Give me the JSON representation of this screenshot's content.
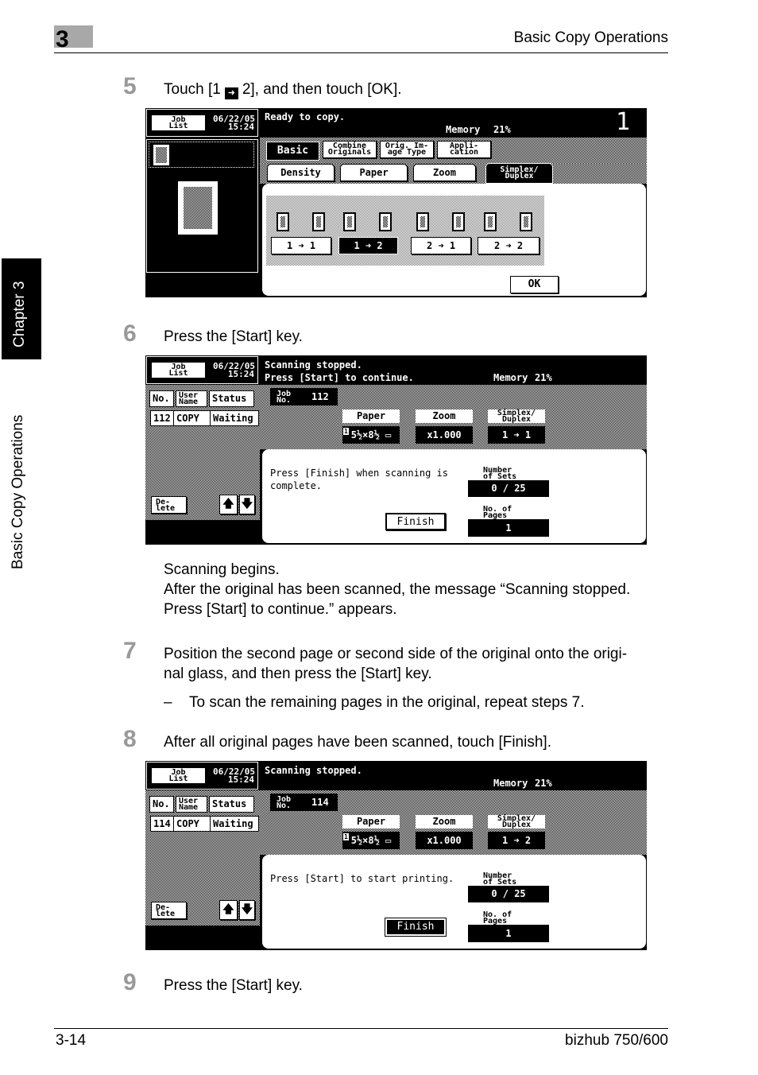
{
  "header": {
    "chapter_number": "3",
    "title": "Basic Copy Operations"
  },
  "side": {
    "chapter": "Chapter 3",
    "section": "Basic Copy Operations"
  },
  "steps": [
    {
      "num": "5",
      "text_before": "Touch [1",
      "text_after": "2], and then touch [OK].",
      "icon": "duplex-arrow-icon"
    },
    {
      "num": "6",
      "text": "Press the [Start] key.",
      "after": [
        "Scanning begins.",
        "After the original has been scanned, the message “Scanning stopped.",
        "Press [Start] to continue.” appears."
      ]
    },
    {
      "num": "7",
      "lines": [
        "Position the second page or second side of the original onto the origi-",
        "nal glass, and then press the [Start] key."
      ],
      "sub_dash": "–",
      "sub": "To scan the remaining pages in the original, repeat steps 7."
    },
    {
      "num": "8",
      "text": "After all original pages have been scanned, touch [Finish]."
    },
    {
      "num": "9",
      "text": "Press the [Start] key."
    }
  ],
  "screen1": {
    "job_list": [
      "Job",
      "List"
    ],
    "date": "06/22/05",
    "time": "15:24",
    "status": "Ready to copy.",
    "memory_label": "Memory",
    "memory": "21%",
    "copies": "1",
    "tabs": [
      [
        "Basic"
      ],
      [
        "Combine",
        "Originals"
      ],
      [
        "Orig. Im-",
        "age Type"
      ],
      [
        "Appli-",
        "cation"
      ]
    ],
    "subtabs": [
      [
        "Density"
      ],
      [
        "Paper"
      ],
      [
        "Zoom"
      ],
      [
        "Simplex/",
        "Duplex"
      ]
    ],
    "options": [
      "1 ➜ 1",
      "1 ➜ 2",
      "2 ➜ 1",
      "2 ➜ 2"
    ],
    "selected_option": "1 ➜ 2",
    "ok": "OK"
  },
  "screen2": {
    "job_list": [
      "Job",
      "List"
    ],
    "date": "06/22/05",
    "time": "15:24",
    "status": [
      "Scanning stopped.",
      "Press [Start] to continue."
    ],
    "memory_label": "Memory",
    "memory": "21%",
    "table": {
      "headers": [
        "No.",
        [
          "User",
          "Name"
        ],
        "Status"
      ],
      "row": [
        "112",
        "COPY",
        "Waiting"
      ]
    },
    "delete": [
      "De-",
      "lete"
    ],
    "job_no_label": [
      "Job",
      "No."
    ],
    "job_no": "112",
    "paper_label": "Paper",
    "paper_tray": "1",
    "paper": "5½×8½ ▭",
    "zoom_label": "Zoom",
    "zoom": "x1.000",
    "duplex_label": [
      "Simplex/",
      "Duplex"
    ],
    "duplex": "1 ➜ 1",
    "message": [
      "Press [Finish] when scanning is",
      "complete."
    ],
    "sets_label": [
      "Number",
      "of Sets"
    ],
    "sets": "0 / 25",
    "pages_label": [
      "No. of",
      "Pages"
    ],
    "pages": "1",
    "finish": "Finish"
  },
  "screen3": {
    "job_list": [
      "Job",
      "List"
    ],
    "date": "06/22/05",
    "time": "15:24",
    "status": [
      "Scanning stopped."
    ],
    "memory_label": "Memory",
    "memory": "21%",
    "table": {
      "headers": [
        "No.",
        [
          "User",
          "Name"
        ],
        "Status"
      ],
      "row": [
        "114",
        "COPY",
        "Waiting"
      ]
    },
    "delete": [
      "De-",
      "lete"
    ],
    "job_no_label": [
      "Job",
      "No."
    ],
    "job_no": "114",
    "paper_label": "Paper",
    "paper_tray": "1",
    "paper": "5½×8½ ▭",
    "zoom_label": "Zoom",
    "zoom": "x1.000",
    "duplex_label": [
      "Simplex/",
      "Duplex"
    ],
    "duplex": "1 ➜ 2",
    "message": [
      "Press [Start] to start printing."
    ],
    "sets_label": [
      "Number",
      "of Sets"
    ],
    "sets": "0 / 25",
    "pages_label": [
      "No. of",
      "Pages"
    ],
    "pages": "1",
    "finish": "Finish"
  },
  "footer": {
    "page": "3-14",
    "product": "bizhub 750/600"
  }
}
